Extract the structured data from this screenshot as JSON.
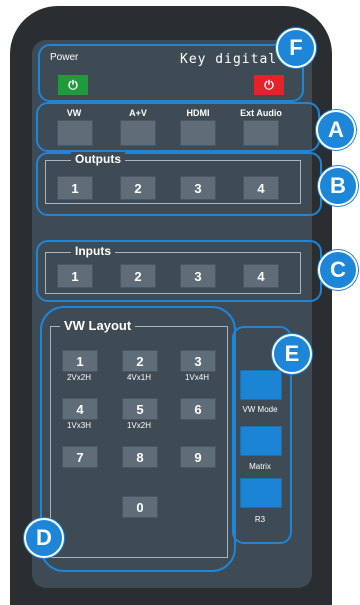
{
  "brand": "Key digital",
  "power": {
    "label": "Power",
    "on_symbol": "⏻",
    "off_symbol": "⏻",
    "on_color": "#1f9b3c",
    "off_color": "#e8202a"
  },
  "badges": {
    "a": "A",
    "b": "B",
    "c": "C",
    "d": "D",
    "e": "E",
    "f": "F"
  },
  "source_buttons": [
    "VW",
    "A+V",
    "HDMI",
    "Ext Audio"
  ],
  "outputs": {
    "title": "Outputs",
    "buttons": [
      "1",
      "2",
      "3",
      "4"
    ]
  },
  "inputs": {
    "title": "Inputs",
    "buttons": [
      "1",
      "2",
      "3",
      "4"
    ]
  },
  "vw_layout": {
    "title": "VW Layout",
    "keys": [
      "1",
      "2",
      "3",
      "4",
      "5",
      "6",
      "7",
      "8",
      "9",
      "0"
    ],
    "sublabels": [
      "2Vx2H",
      "4Vx1H",
      "1Vx4H",
      "1Vx3H",
      "1Vx2H"
    ]
  },
  "side_buttons": [
    "VW Mode",
    "Matrix",
    "R3"
  ],
  "accent": "#1e86d8"
}
